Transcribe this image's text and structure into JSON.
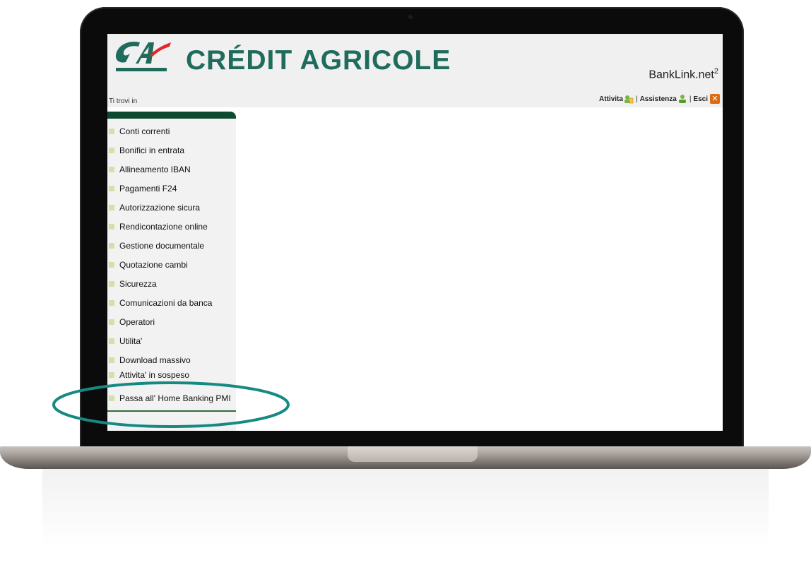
{
  "header": {
    "brand_name": "CRÉDIT AGRICOLE",
    "product_name": "BankLink.net",
    "product_suffix": "2",
    "breadcrumb": "Ti trovi in",
    "links": {
      "activity": "Attivita",
      "assistance": "Assistenza",
      "exit": "Esci",
      "separator": "|"
    }
  },
  "sidebar": {
    "items": [
      {
        "label": "Conti correnti"
      },
      {
        "label": "Bonifici in entrata"
      },
      {
        "label": "Allineamento IBAN"
      },
      {
        "label": "Pagamenti F24"
      },
      {
        "label": "Autorizzazione sicura"
      },
      {
        "label": "Rendicontazione online"
      },
      {
        "label": "Gestione documentale"
      },
      {
        "label": "Quotazione cambi"
      },
      {
        "label": "Sicurezza"
      },
      {
        "label": "Comunicazioni da banca"
      },
      {
        "label": "Operatori"
      },
      {
        "label": "Utilita'"
      },
      {
        "label": "Download massivo"
      },
      {
        "label": "Attivita' in sospeso"
      },
      {
        "label": "Passa all' Home Banking PMI"
      }
    ]
  },
  "colors": {
    "brand_green": "#1f6b5c",
    "brand_red": "#e0262b",
    "sidebar_header": "#0e4a32",
    "bullet": "#cfe3a6",
    "highlight_ring": "#168a82",
    "exit_icon": "#e06a12"
  },
  "icons": [
    "activity-icon",
    "assistance-icon",
    "exit-icon",
    "bullet-icon"
  ]
}
